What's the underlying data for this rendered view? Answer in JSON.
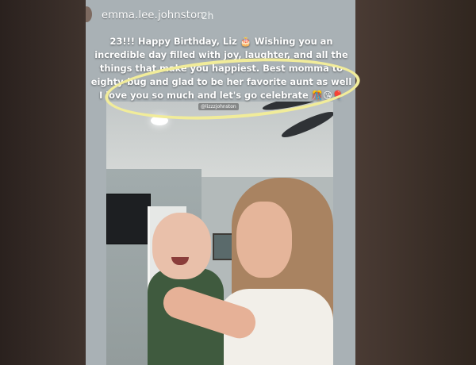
{
  "header": {
    "username": "emma.lee.johnston",
    "timestamp": "2h"
  },
  "caption": {
    "lines": [
      "23!!! Happy Birthday, Liz 🎂 Wishing you an",
      "incredible day filled with joy, laughter, and all the",
      "things that make you happiest. Best momma to",
      "eighty-bug and glad to be her favorite aunt as well",
      "I love you so much and let's go celebrate 🎊😘🎈"
    ],
    "mention": "@lizzzjohnston"
  },
  "colors": {
    "annotation": "#f1ec9a"
  }
}
